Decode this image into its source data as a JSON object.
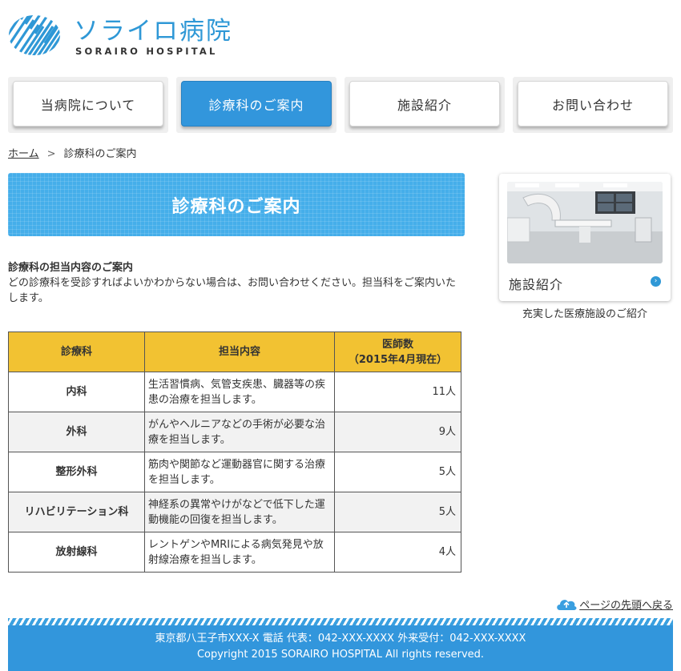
{
  "header": {
    "logo_jp": "ソライロ病院",
    "logo_en": "SORAIRO HOSPITAL"
  },
  "nav": {
    "items": [
      {
        "label": "当病院について",
        "active": false
      },
      {
        "label": "診療科のご案内",
        "active": true
      },
      {
        "label": "施設紹介",
        "active": false
      },
      {
        "label": "お問い合わせ",
        "active": false
      }
    ]
  },
  "breadcrumb": {
    "home": "ホーム",
    "separator": ">",
    "current": "診療科のご案内"
  },
  "main": {
    "title": "診療科のご案内",
    "intro_heading": "診療科の担当内容のご案内",
    "intro_text": "どの診療科を受診すればよいかわからない場合は、お問い合わせください。担当科をご案内いたします。",
    "table": {
      "headers": [
        "診療科",
        "担当内容",
        "医師数",
        "（2015年4月現在）"
      ],
      "rows": [
        {
          "dept": "内科",
          "desc": "生活習慣病、気管支疾患、臓器等の疾患の治療を担当します。",
          "doctors": "11人"
        },
        {
          "dept": "外科",
          "desc": "がんやヘルニアなどの手術が必要な治療を担当します。",
          "doctors": "9人"
        },
        {
          "dept": "整形外科",
          "desc": "筋肉や関節など運動器官に関する治療を担当します。",
          "doctors": "5人"
        },
        {
          "dept": "リハビリテーション科",
          "desc": "神経系の異常やけがなどで低下した運動機能の回復を担当します。",
          "doctors": "5人"
        },
        {
          "dept": "放射線科",
          "desc": "レントゲンやMRIによる病気発見や放射線治療を担当します。",
          "doctors": "4人"
        }
      ]
    }
  },
  "sidebar": {
    "card_label": "施設紹介",
    "caption": "充実した医療施設のご紹介"
  },
  "pagetop": {
    "label": "ページの先頭へ戻る"
  },
  "footer": {
    "address": "東京都八王子市XXX-X 電話 代表：042-XXX-XXXX 外来受付：042-XXX-XXXX",
    "copyright": "Copyright 2015 SORAIRO HOSPITAL All rights reserved."
  },
  "colors": {
    "brand_blue": "#3296dc",
    "table_header": "#f2c232"
  }
}
